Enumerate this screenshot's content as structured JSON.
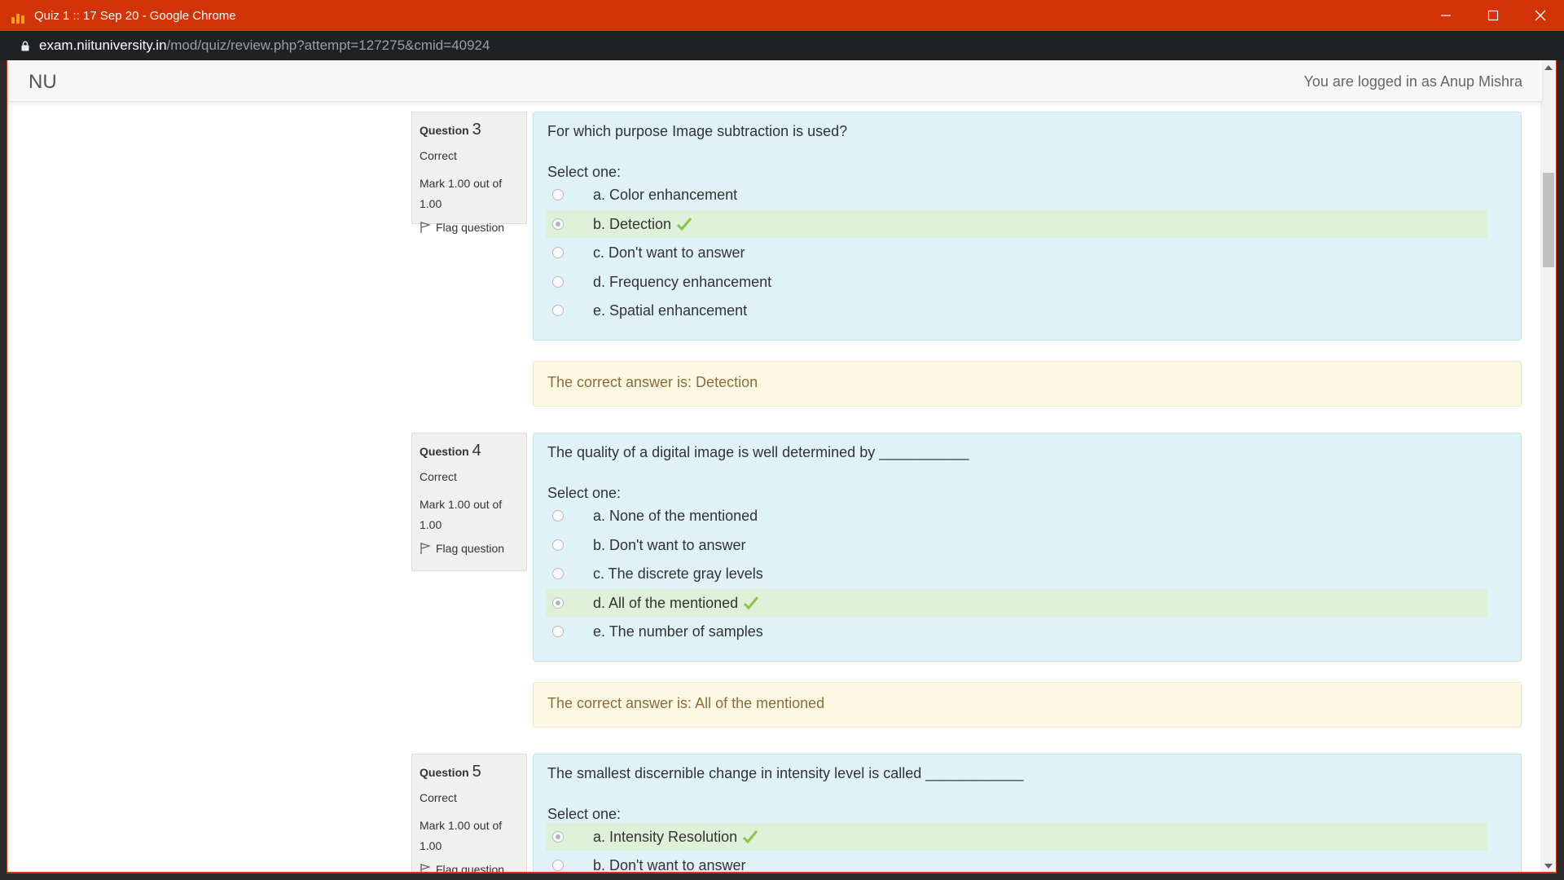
{
  "window": {
    "title": "Quiz 1 :: 17 Sep 20 - Google Chrome",
    "url_host": "exam.niituniversity.in",
    "url_path": "/mod/quiz/review.php?attempt=127275&cmid=40924"
  },
  "navbar": {
    "brand": "NU",
    "login_text": "You are logged in as Anup Mishra"
  },
  "questions": [
    {
      "label": "Question",
      "number": "3",
      "state": "Correct",
      "grade": "Mark 1.00 out of 1.00",
      "flag_label": "Flag question",
      "text": "For which purpose Image subtraction is used?",
      "prompt": "Select one:",
      "options": [
        {
          "label": "a. Color enhancement",
          "selected": false,
          "correct": false
        },
        {
          "label": "b. Detection",
          "selected": true,
          "correct": true
        },
        {
          "label": "c. Don't want to answer",
          "selected": false,
          "correct": false
        },
        {
          "label": "d. Frequency enhancement",
          "selected": false,
          "correct": false
        },
        {
          "label": "e. Spatial enhancement",
          "selected": false,
          "correct": false
        }
      ],
      "right_answer": "The correct answer is: Detection"
    },
    {
      "label": "Question",
      "number": "4",
      "state": "Correct",
      "grade": "Mark 1.00 out of 1.00",
      "flag_label": "Flag question",
      "text": "The quality of a digital image is well determined by ___________",
      "prompt": "Select one:",
      "options": [
        {
          "label": "a. None of the mentioned",
          "selected": false,
          "correct": false
        },
        {
          "label": "b. Don't want to answer",
          "selected": false,
          "correct": false
        },
        {
          "label": "c. The discrete gray levels",
          "selected": false,
          "correct": false
        },
        {
          "label": "d. All of the mentioned",
          "selected": true,
          "correct": true
        },
        {
          "label": "e. The number of samples",
          "selected": false,
          "correct": false
        }
      ],
      "right_answer": "The correct answer is: All of the mentioned"
    },
    {
      "label": "Question",
      "number": "5",
      "state": "Correct",
      "grade": "Mark 1.00 out of 1.00",
      "flag_label": "Flag question",
      "text": "The smallest discernible change in intensity level is called ____________",
      "prompt": "Select one:",
      "options": [
        {
          "label": "a. Intensity Resolution",
          "selected": true,
          "correct": true
        },
        {
          "label": "b. Don't want to answer",
          "selected": false,
          "correct": false
        }
      ]
    }
  ],
  "colors": {
    "chrome_titlebar": "#d23308",
    "question_bg": "#def2f8",
    "correct_option_bg": "#dff0d8",
    "outcome_bg": "#fcf8e3",
    "check_green": "#8bc34a"
  }
}
